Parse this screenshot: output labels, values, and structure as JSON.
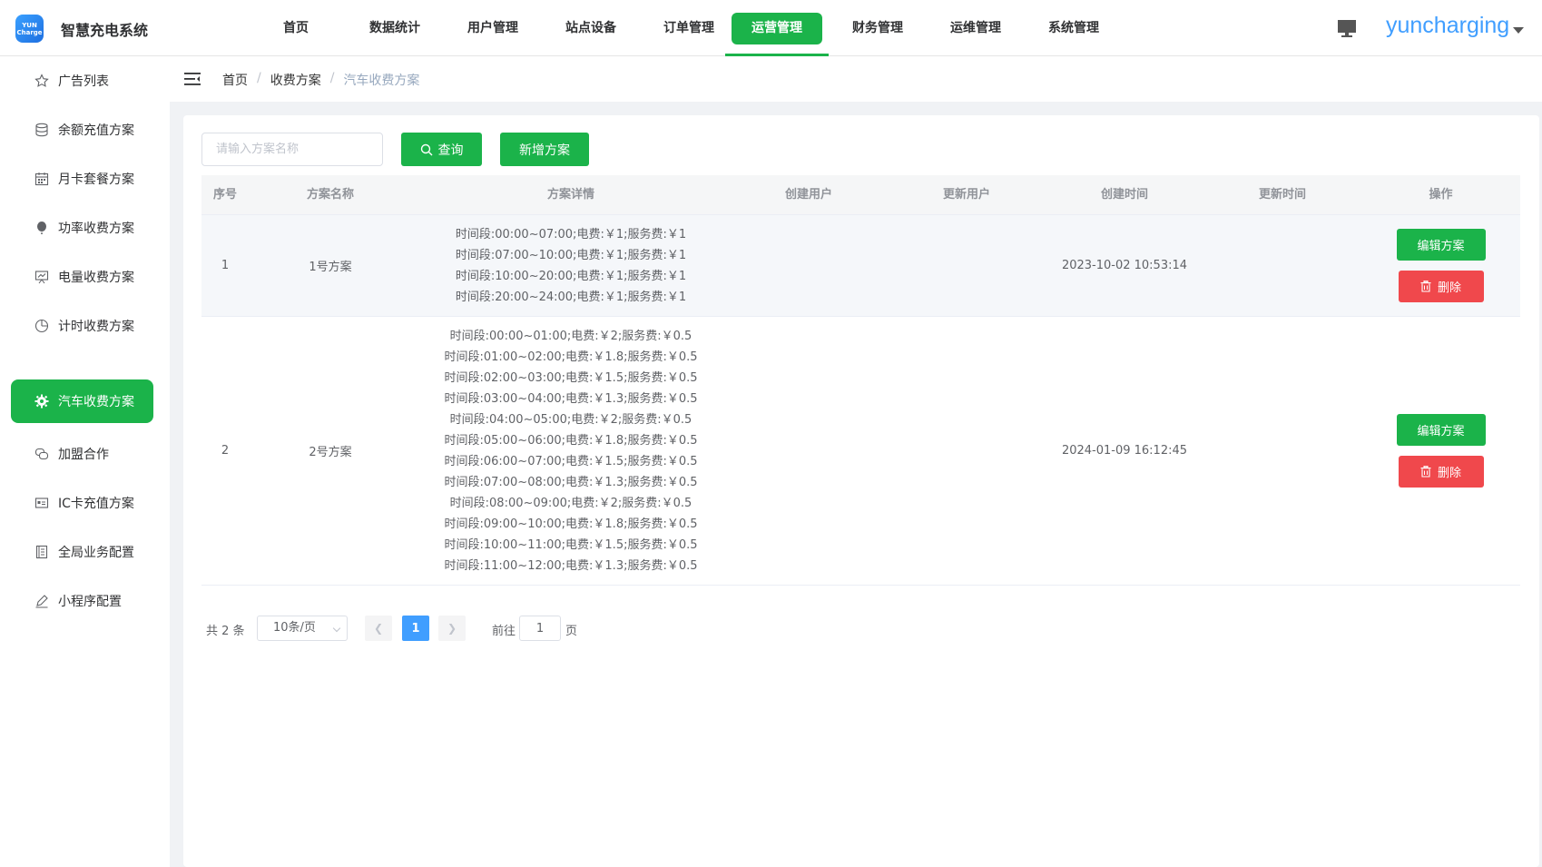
{
  "app": {
    "logo_text_top": "YUN",
    "logo_text_bottom": "Charge",
    "title": "智慧充电系统",
    "username": "yuncharging"
  },
  "topnav": [
    {
      "label": "首页"
    },
    {
      "label": "数据统计"
    },
    {
      "label": "用户管理"
    },
    {
      "label": "站点设备"
    },
    {
      "label": "订单管理"
    },
    {
      "label": "运营管理",
      "active": true
    },
    {
      "label": "财务管理"
    },
    {
      "label": "运维管理"
    },
    {
      "label": "系统管理"
    }
  ],
  "sidebar": [
    {
      "label": "广告列表",
      "icon": "star-icon"
    },
    {
      "label": "余额充值方案",
      "icon": "database-icon"
    },
    {
      "label": "月卡套餐方案",
      "icon": "calendar-icon"
    },
    {
      "label": "功率收费方案",
      "icon": "balloon-icon"
    },
    {
      "label": "电量收费方案",
      "icon": "chart-board-icon"
    },
    {
      "label": "计时收费方案",
      "icon": "pie-clock-icon"
    },
    {
      "label": "汽车收费方案",
      "icon": "gear-icon",
      "active": true
    },
    {
      "label": "加盟合作",
      "icon": "chat-icon"
    },
    {
      "label": "IC卡充值方案",
      "icon": "card-icon"
    },
    {
      "label": "全局业务配置",
      "icon": "document-icon"
    },
    {
      "label": "小程序配置",
      "icon": "pen-icon"
    }
  ],
  "breadcrumb": {
    "home": "首页",
    "parent": "收费方案",
    "current": "汽车收费方案",
    "sep": "/"
  },
  "toolbar": {
    "search_placeholder": "请输入方案名称",
    "query_label": "查询",
    "add_label": "新增方案"
  },
  "table": {
    "columns": [
      "序号",
      "方案名称",
      "方案详情",
      "创建用户",
      "更新用户",
      "创建时间",
      "更新时间",
      "操作"
    ],
    "rows": [
      {
        "index": "1",
        "name": "1号方案",
        "details": [
          "时间段:00:00~07:00;电费:￥1;服务费:￥1",
          "时间段:07:00~10:00;电费:￥1;服务费:￥1",
          "时间段:10:00~20:00;电费:￥1;服务费:￥1",
          "时间段:20:00~24:00;电费:￥1;服务费:￥1"
        ],
        "create_user": "",
        "update_user": "",
        "create_time": "2023-10-02 10:53:14",
        "update_time": "",
        "edit_label": "编辑方案",
        "delete_label": "删除"
      },
      {
        "index": "2",
        "name": "2号方案",
        "details": [
          "时间段:00:00~01:00;电费:￥2;服务费:￥0.5",
          "时间段:01:00~02:00;电费:￥1.8;服务费:￥0.5",
          "时间段:02:00~03:00;电费:￥1.5;服务费:￥0.5",
          "时间段:03:00~04:00;电费:￥1.3;服务费:￥0.5",
          "时间段:04:00~05:00;电费:￥2;服务费:￥0.5",
          "时间段:05:00~06:00;电费:￥1.8;服务费:￥0.5",
          "时间段:06:00~07:00;电费:￥1.5;服务费:￥0.5",
          "时间段:07:00~08:00;电费:￥1.3;服务费:￥0.5",
          "时间段:08:00~09:00;电费:￥2;服务费:￥0.5",
          "时间段:09:00~10:00;电费:￥1.8;服务费:￥0.5",
          "时间段:10:00~11:00;电费:￥1.5;服务费:￥0.5",
          "时间段:11:00~12:00;电费:￥1.3;服务费:￥0.5"
        ],
        "create_user": "",
        "update_user": "",
        "create_time": "2024-01-09 16:12:45",
        "update_time": "",
        "edit_label": "编辑方案",
        "delete_label": "删除"
      }
    ]
  },
  "pagination": {
    "total": "共 2 条",
    "page_size": "10条/页",
    "current_page": "1",
    "goto_label": "前往",
    "goto_value": "1",
    "page_suffix": "页"
  },
  "colors": {
    "accent": "#1bb34a",
    "danger": "#f0484c",
    "link": "#409eff"
  }
}
